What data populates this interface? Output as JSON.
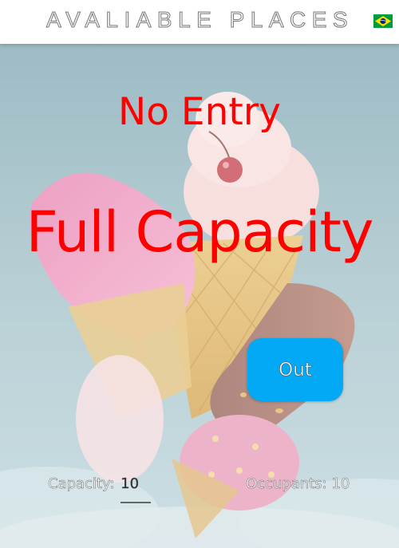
{
  "header": {
    "title": "AVALIABLE PLACES",
    "flag_icon": "brazil-flag-icon"
  },
  "status": {
    "no_entry": "No Entry",
    "full_capacity": "Full Capacity"
  },
  "out_button": {
    "label": "Out"
  },
  "capacity": {
    "label": "Capacity:",
    "value": "10"
  },
  "occupants": {
    "label": "Occupants:",
    "value": "10"
  },
  "colors": {
    "alert": "#ff0000",
    "button": "#03a9f4",
    "header_bg": "#ffffff"
  }
}
